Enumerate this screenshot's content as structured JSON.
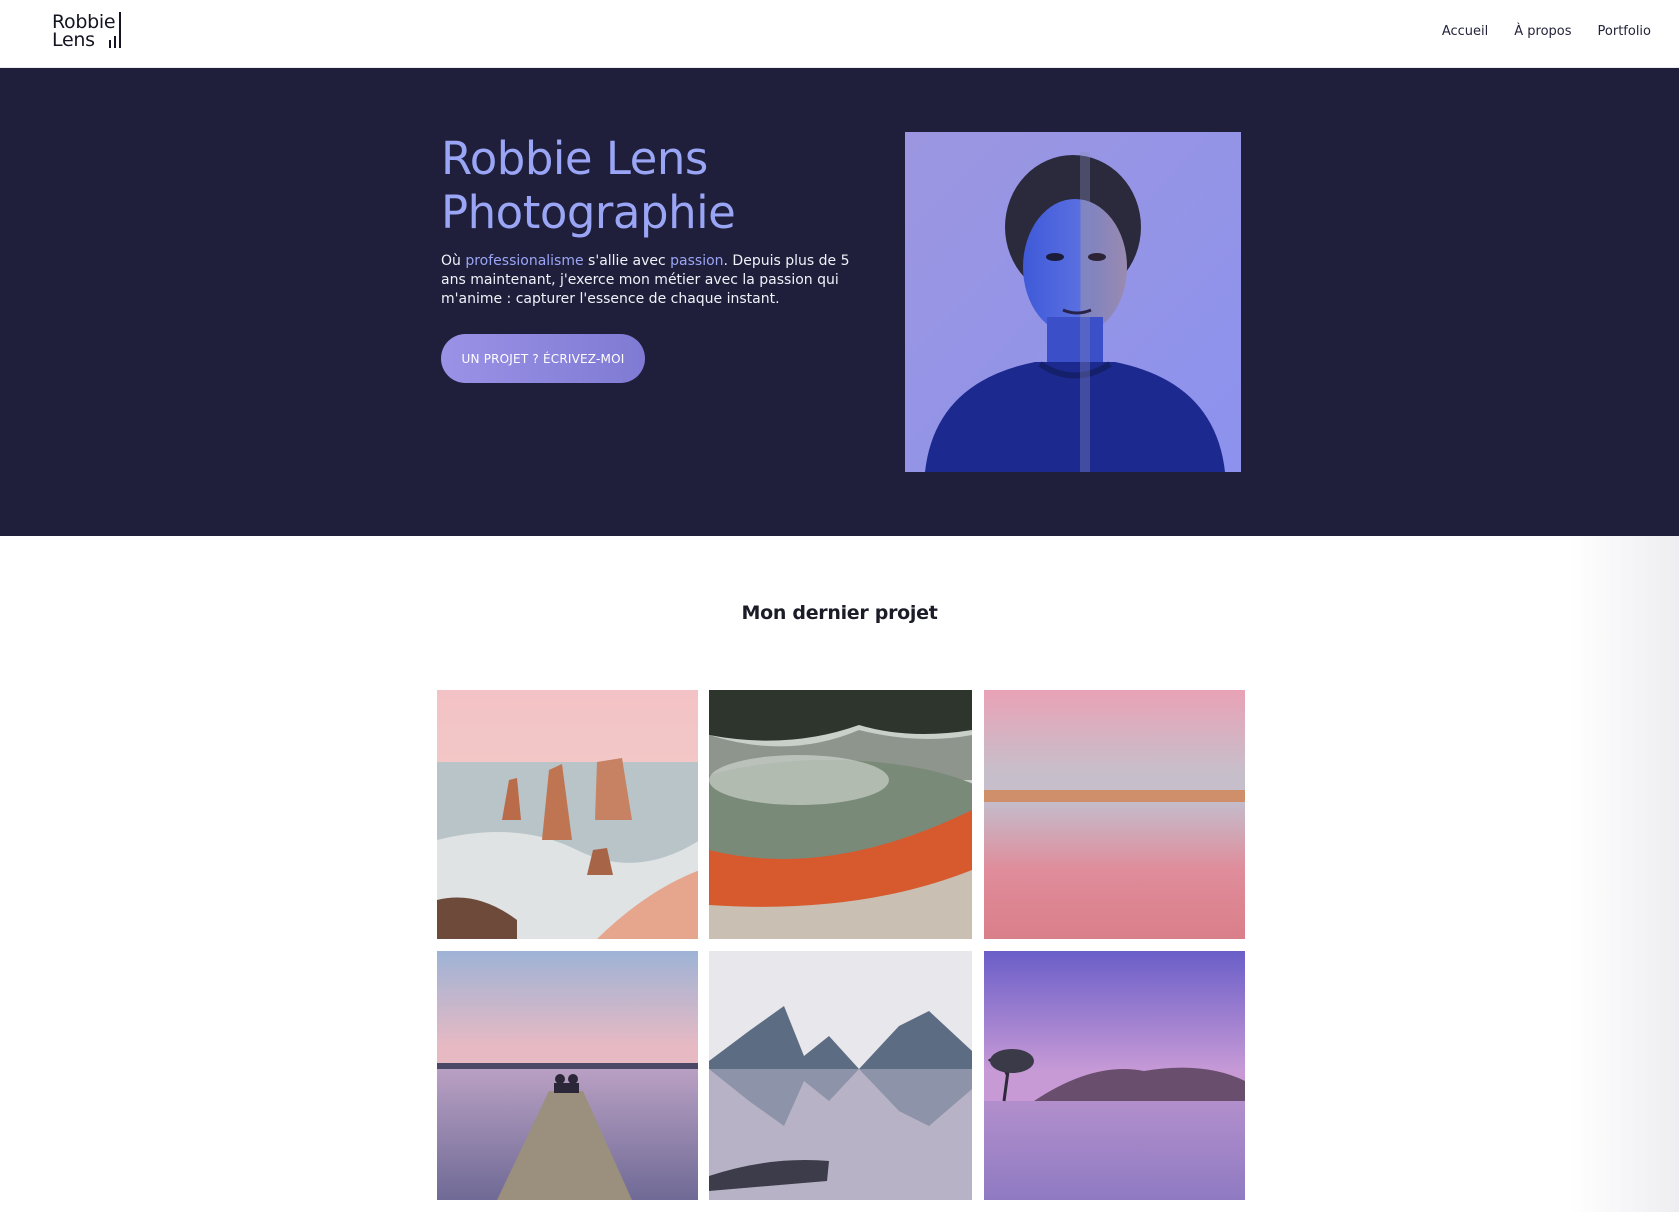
{
  "logo": {
    "line1": "Robbie",
    "line2": "Lens"
  },
  "nav": {
    "items": [
      "Accueil",
      "À propos",
      "Portfolio"
    ]
  },
  "hero": {
    "title_line1": "Robbie Lens",
    "title_line2": "Photographie",
    "text_part1": "Où ",
    "text_accent1": "professionalisme",
    "text_part2": " s'allie avec ",
    "text_accent2": "passion",
    "text_part3": ". Depuis plus de 5 ans maintenant, j'exerce mon métier avec la passion qui m'anime : capturer l'essence de chaque instant.",
    "cta_label": "UN PROJET ? ÉCRIVEZ-MOI",
    "portrait_icon": "portrait-photo"
  },
  "section": {
    "title": "Mon dernier projet"
  },
  "gallery": {
    "images": [
      "sea-stacks-photo",
      "hot-spring-photo",
      "pink-lake-photo",
      "pier-couple-photo",
      "mountain-reflection-photo",
      "lone-tree-lake-photo"
    ]
  },
  "colors": {
    "hero_bg": "#1f1f3b",
    "accent": "#9aa5f6",
    "cta": "#8f88de"
  }
}
